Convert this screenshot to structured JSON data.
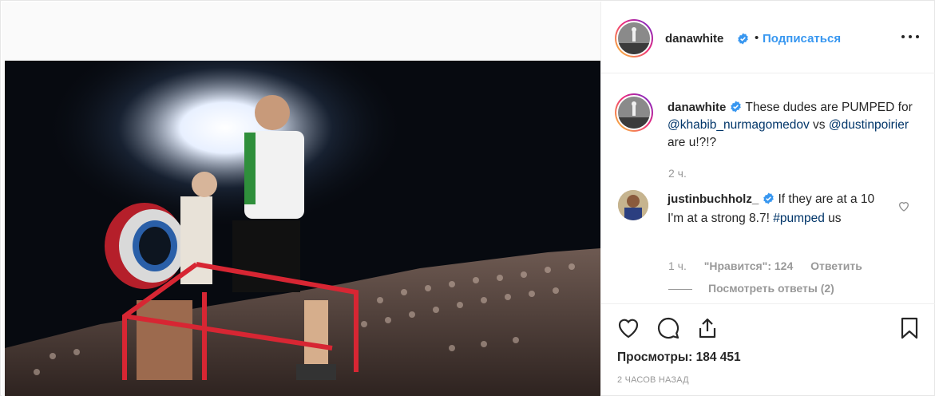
{
  "post": {
    "author": "danawhite",
    "follow_label": "Подписаться",
    "separator": "•",
    "more_icon": "more-horizontal-icon",
    "verified_icon": "verified-badge-icon"
  },
  "caption": {
    "author": "danawhite",
    "text_1": "These dudes are PUMPED for ",
    "mention_1": "@khabib_nurmagomedov",
    "text_2": " vs ",
    "mention_2": "@dustinpoirier",
    "text_3": " are u!?!?",
    "time": "2 ч."
  },
  "comment": {
    "author": "justinbuchholz_",
    "text": "If they are at a 10 I'm at a strong 8.7! ",
    "hashtag": "#pumped",
    "tail": " us",
    "time": "1 ч.",
    "likes": "\"Нравится\": 124",
    "reply_label": "Ответить",
    "view_replies": "Посмотреть ответы (2)"
  },
  "actions": {
    "like_icon": "heart-icon",
    "comment_icon": "comment-icon",
    "share_icon": "share-icon",
    "save_icon": "bookmark-icon",
    "views": "Просмотры: 184 451",
    "age": "2 часов назад"
  },
  "colors": {
    "link_blue": "#3897f0",
    "mention": "#003569",
    "muted": "#999999",
    "text": "#262626"
  }
}
